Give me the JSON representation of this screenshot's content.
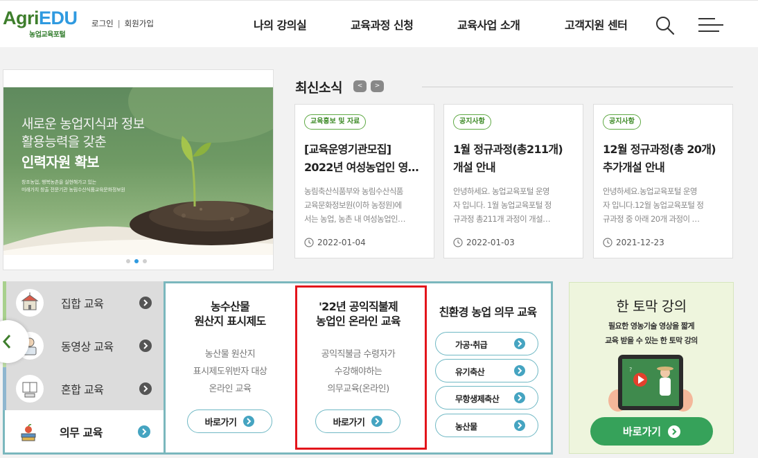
{
  "header": {
    "logo_main_1": "Agri",
    "logo_main_2": "EDU",
    "logo_sub": "농업교육포털",
    "login": "로그인",
    "auth_sep": "|",
    "signup": "회원가입",
    "nav": [
      "나의 강의실",
      "교육과정 신청",
      "교육사업 소개",
      "고객지원 센터"
    ]
  },
  "banner": {
    "line1": "새로운 농업지식과 정보",
    "line2": "활용능력을 갖춘",
    "line3": "인력자원 확보",
    "small1": "창조농업, 행복농촌을 실현해가고 있는",
    "small2": "미래가치 창출 전문기관 농림수산식품교육문화정보원",
    "active_slide": 2,
    "slide_count": 3
  },
  "news": {
    "title": "최신소식",
    "prev": "<",
    "next": ">",
    "cards": [
      {
        "tag": "교육홍보 및 자료",
        "title1": "[교육운영기관모집]",
        "title2": "2022년 여성농업인 영…",
        "desc1": "농림축산식품부와 농림수산식품",
        "desc2": "교육문화정보원(이하 농정원)에",
        "desc3": "서는 농업, 농촌 내 여성농업인…",
        "date": "2022-01-04"
      },
      {
        "tag": "공지사항",
        "title1": "1월 정규과정(총211개)",
        "title2": "개설 안내",
        "desc1": "안녕하세요. 농업교육포털 운영",
        "desc2": "자 입니다. 1월 농업교육포털 정",
        "desc3": "규과정 총211개 과정이 개설…",
        "date": "2022-01-03"
      },
      {
        "tag": "공지사항",
        "title1": "12월 정규과정(총 20개)",
        "title2": "추가개설 안내",
        "desc1": "안녕하세요.농업교육포털 운영",
        "desc2": "자 입니다.12월 농업교육포털 정",
        "desc3": "규과정 중 아래 20개 과정이 …",
        "date": "2021-12-23"
      }
    ]
  },
  "categories": [
    {
      "label": "집합 교육",
      "icon": "school-building-icon"
    },
    {
      "label": "동영상 교육",
      "icon": "video-lecture-icon"
    },
    {
      "label": "혼합 교육",
      "icon": "book-laptop-icon"
    },
    {
      "label": "의무 교육",
      "icon": "books-apple-icon"
    }
  ],
  "panel": {
    "col1": {
      "title1": "농수산물",
      "title2": "원산지 표시제도",
      "desc1": "농산물 원산지",
      "desc2": "표시제도위반자 대상",
      "desc3": "온라인 교육",
      "button": "바로가기"
    },
    "col2": {
      "title1": "'22년 공익직불제",
      "title2": "농업인 온라인 교육",
      "desc1": "공익직불금 수령자가",
      "desc2": "수강해야하는",
      "desc3": "의무교육(온라인)",
      "button": "바로가기"
    },
    "col3": {
      "title": "친환경 농업 의무 교육",
      "options": [
        "가공·취급",
        "유기축산",
        "무항생제축산",
        "농산물"
      ]
    }
  },
  "mini": {
    "title": "한 토막 강의",
    "desc1": "필요한 영농기술 영상을 짧게",
    "desc2": "교육 받을 수 있는 한 토막 강의",
    "button": "바로가기"
  },
  "colors": {
    "accent_green": "#36a25a",
    "teal_border": "#7ab7bd",
    "highlight_red": "#e3141b",
    "logo_blue": "#2f9ae0"
  }
}
